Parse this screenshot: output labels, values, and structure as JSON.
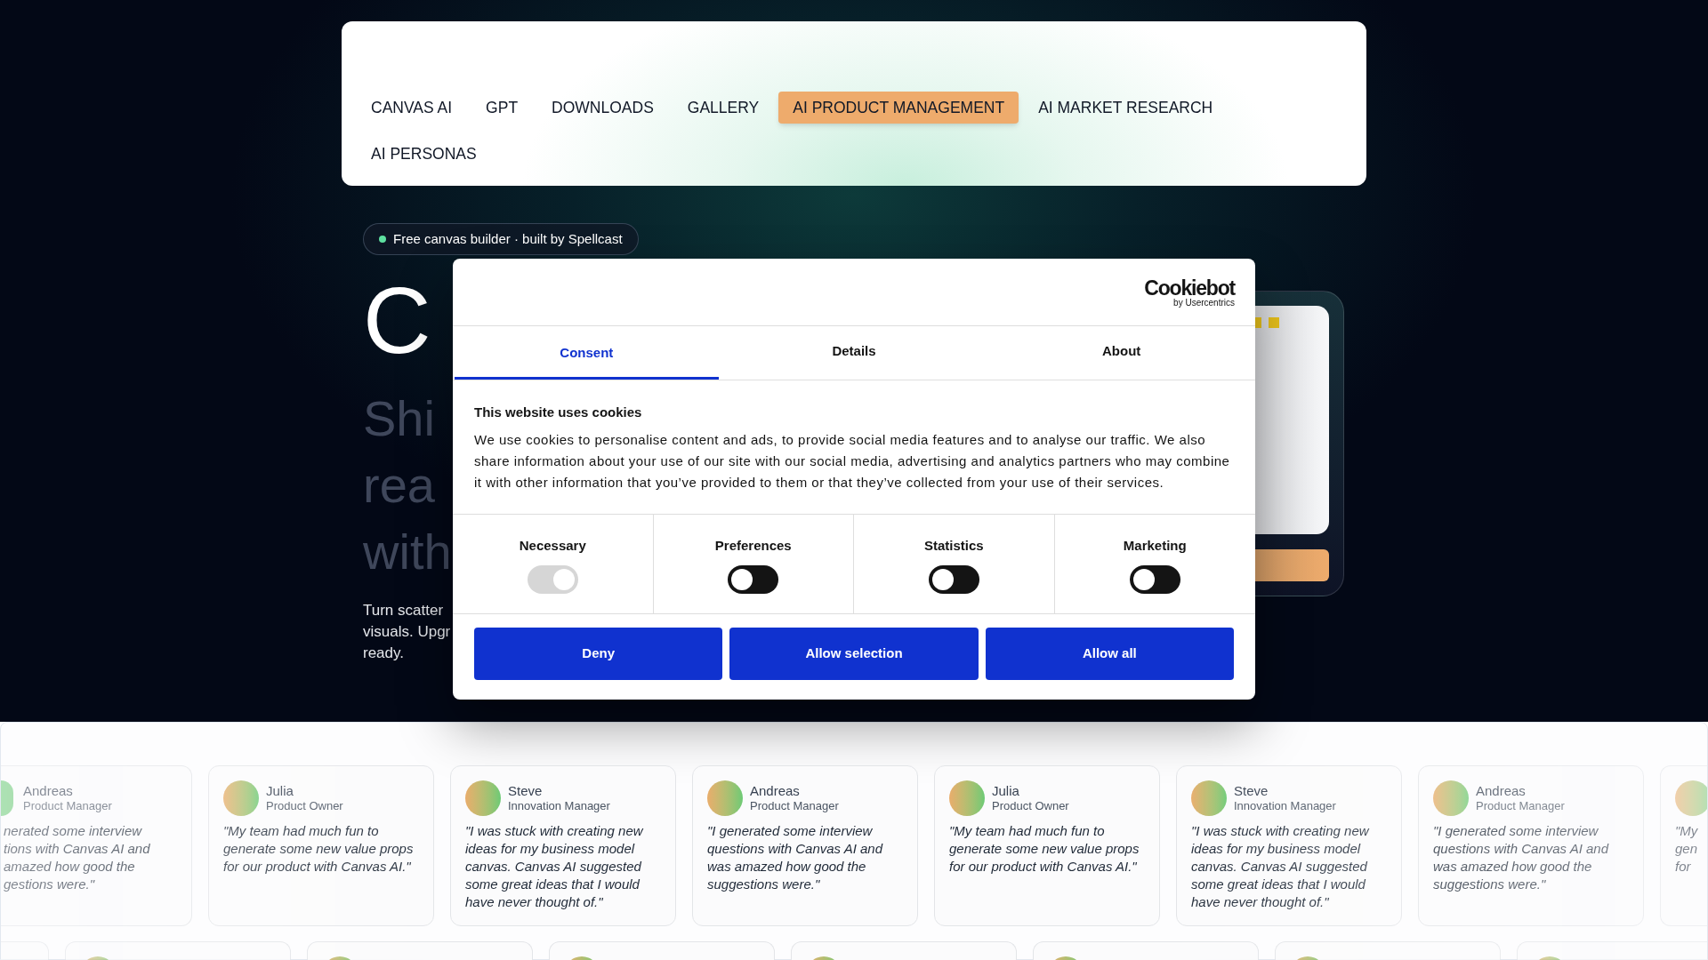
{
  "nav": {
    "items": [
      {
        "label": "CANVAS AI",
        "selected": false
      },
      {
        "label": "GPT",
        "selected": false
      },
      {
        "label": "DOWNLOADS",
        "selected": false
      },
      {
        "label": "GALLERY",
        "selected": false
      },
      {
        "label": "AI PRODUCT MANAGEMENT",
        "selected": true
      },
      {
        "label": "AI MARKET RESEARCH",
        "selected": false
      },
      {
        "label": "AI PERSONAS",
        "selected": false
      }
    ]
  },
  "hero": {
    "badge": "Free canvas builder · built by Spellcast",
    "title": "C",
    "subtitle_lines": [
      "Shi",
      "rea",
      "with"
    ],
    "description_lines": [
      "Turn scatter",
      "visuals. Upgr",
      "ready."
    ]
  },
  "cookie_dialog": {
    "logo": {
      "wordmark": "Cookiebot",
      "tagline": "by Usercentrics"
    },
    "tabs": [
      {
        "label": "Consent",
        "selected": true
      },
      {
        "label": "Details",
        "selected": false
      },
      {
        "label": "About",
        "selected": false
      }
    ],
    "heading": "This website uses cookies",
    "body": "We use cookies to personalise content and ads, to provide social media features and to analyse our traffic. We also share information about your use of our site with our social media, advertising and analytics partners who may combine it with other information that you’ve provided to them or that they’ve collected from your use of their services.",
    "categories": [
      {
        "label": "Necessary",
        "checked": true,
        "disabled": true
      },
      {
        "label": "Preferences",
        "checked": false,
        "disabled": false
      },
      {
        "label": "Statistics",
        "checked": false,
        "disabled": false
      },
      {
        "label": "Marketing",
        "checked": false,
        "disabled": false
      }
    ],
    "buttons": [
      "Deny",
      "Allow selection",
      "Allow all"
    ]
  },
  "testimonials": [
    {
      "kind": "cut_left",
      "name": "Andreas",
      "role": "Product Manager",
      "quote": "nerated some interview\ntions with Canvas AI and\namazed how good the\ngestions were.\""
    },
    {
      "kind": "full",
      "name": "Julia",
      "role": "Product Owner",
      "quote": "\"My team had much fun to\ngenerate some new value props\nfor our product with Canvas AI.\""
    },
    {
      "kind": "full",
      "name": "Steve",
      "role": "Innovation Manager",
      "quote": "\"I was stuck with creating new\nideas for my business model\ncanvas. Canvas AI suggested\nsome great ideas that I would\nhave never thought of.\""
    },
    {
      "kind": "full",
      "name": "Andreas",
      "role": "Product Manager",
      "quote": "\"I generated some interview\nquestions with Canvas AI and\nwas amazed how good the\nsuggestions were.\""
    },
    {
      "kind": "full",
      "name": "Julia",
      "role": "Product Owner",
      "quote": "\"My team had much fun to\ngenerate some new value props\nfor our product with Canvas AI.\""
    },
    {
      "kind": "full",
      "name": "Steve",
      "role": "Innovation Manager",
      "quote": "\"I was stuck with creating new\nideas for my business model\ncanvas. Canvas AI suggested\nsome great ideas that I would\nhave never thought of.\""
    },
    {
      "kind": "full",
      "name": "Andreas",
      "role": "Product Manager",
      "quote": "\"I generated some interview\nquestions with Canvas AI and\nwas amazed how good the\nsuggestions were.\""
    },
    {
      "kind": "cut_right",
      "quote": "\"My\ngen\nfor"
    }
  ]
}
